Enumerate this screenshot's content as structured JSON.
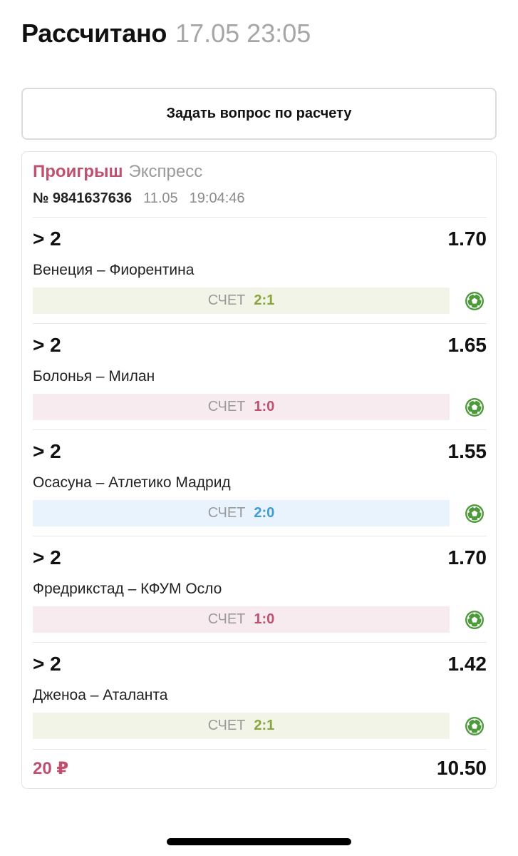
{
  "header": {
    "title": "Рассчитано",
    "datetime": "17.05 23:05"
  },
  "ask_button": {
    "label": "Задать вопрос по расчету"
  },
  "bet": {
    "status": "Проигрыш",
    "type": "Экспресс",
    "number": "№ 9841637636",
    "date": "11.05",
    "time": "19:04:46",
    "events": [
      {
        "outcome": "> 2",
        "odds": "1.70",
        "teams": "Венеция – Фиорентина",
        "score_label": "СЧЕТ",
        "score": "2:1",
        "bar_color": "green"
      },
      {
        "outcome": "> 2",
        "odds": "1.65",
        "teams": "Болонья – Милан",
        "score_label": "СЧЕТ",
        "score": "1:0",
        "bar_color": "pink"
      },
      {
        "outcome": "> 2",
        "odds": "1.55",
        "teams": "Осасуна – Атлетико Мадрид",
        "score_label": "СЧЕТ",
        "score": "2:0",
        "bar_color": "blue"
      },
      {
        "outcome": "> 2",
        "odds": "1.70",
        "teams": "Фредрикстад – КФУМ Осло",
        "score_label": "СЧЕТ",
        "score": "1:0",
        "bar_color": "pink"
      },
      {
        "outcome": "> 2",
        "odds": "1.42",
        "teams": "Дженоа – Аталанта",
        "score_label": "СЧЕТ",
        "score": "2:1",
        "bar_color": "green"
      }
    ],
    "stake": "20 ₽",
    "total_odds": "10.50"
  },
  "icons": {
    "sport": "soccer-ball-icon"
  },
  "colors": {
    "lost": "#c0506f",
    "ball": "#4d9a3a",
    "score_green": "#8aa63a",
    "score_blue": "#3f9ad9"
  }
}
